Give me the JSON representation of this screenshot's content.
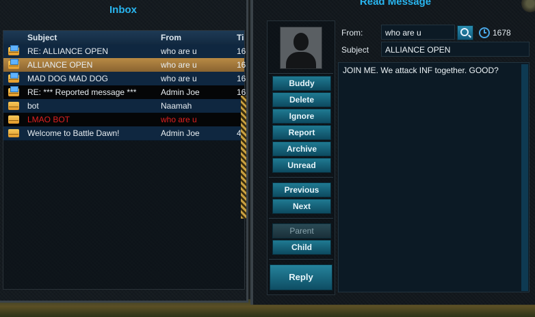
{
  "inbox": {
    "title": "Inbox",
    "columns": {
      "subject": "Subject",
      "from": "From",
      "time": "Ti"
    },
    "messages": [
      {
        "subject": "RE: ALLIANCE OPEN",
        "from": "who are u",
        "time": "16",
        "icon": "envelope-open-icon"
      },
      {
        "subject": "ALLIANCE OPEN",
        "from": "who are u",
        "time": "16",
        "icon": "envelope-open-icon",
        "selected": true
      },
      {
        "subject": "MAD DOG MAD DOG",
        "from": "who are u",
        "time": "16",
        "icon": "envelope-open-icon"
      },
      {
        "subject": "RE: *** Reported message ***",
        "from": "Admin Joe",
        "time": "16",
        "icon": "envelope-open-icon"
      },
      {
        "subject": "bot",
        "from": "Naamah",
        "time": "",
        "icon": "envelope-icon"
      },
      {
        "subject": "LMAO BOT",
        "from": "who are u",
        "time": "",
        "icon": "envelope-icon",
        "alert_color": "#e02020"
      },
      {
        "subject": "Welcome to Battle Dawn!",
        "from": "Admin Joe",
        "time": "4",
        "icon": "envelope-icon"
      }
    ]
  },
  "read": {
    "title": "Read Message",
    "from_label": "From:",
    "from_value": "who are u",
    "subject_label": "Subject",
    "subject_value": "ALLIANCE OPEN",
    "time_value": "1678",
    "body": "JOIN ME. We attack INF together. GOOD?",
    "buttons": {
      "buddy": "Buddy",
      "delete": "Delete",
      "ignore": "Ignore",
      "report": "Report",
      "archive": "Archive",
      "unread": "Unread",
      "previous": "Previous",
      "next": "Next",
      "parent": "Parent",
      "child": "Child",
      "reply": "Reply"
    }
  },
  "colors": {
    "accent_title": "#29b6f0",
    "selected_row": "#b88a45",
    "button": "#1f7a92"
  }
}
